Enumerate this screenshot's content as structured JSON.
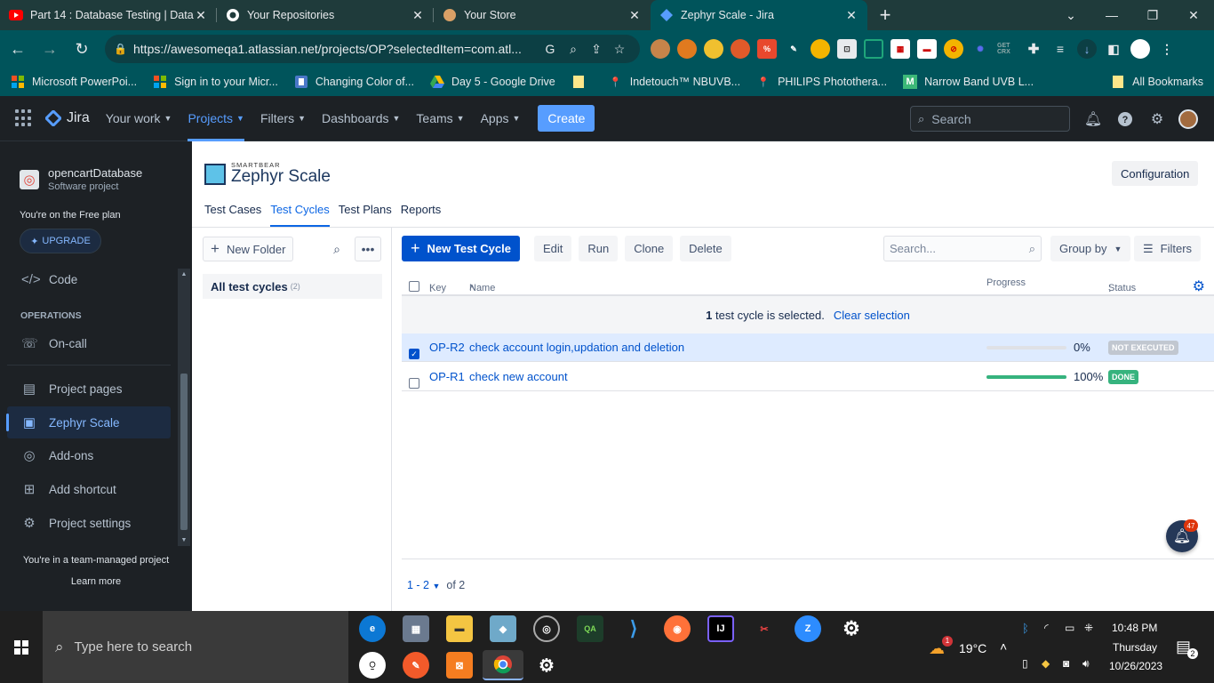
{
  "browser": {
    "tabs": [
      {
        "title": "Part 14 : Database Testing | Data",
        "icon": "youtube-icon",
        "icon_color": "#ff0000"
      },
      {
        "title": "Your Repositories",
        "icon": "github-icon",
        "icon_color": "#ffffff"
      },
      {
        "title": "Your Store",
        "icon": "store-icon",
        "icon_color": "#d9a066"
      },
      {
        "title": "Zephyr Scale - Jira",
        "icon": "jira-icon",
        "icon_color": "#579dff"
      }
    ],
    "url": "https://awesomeqa1.atlassian.net/projects/OP?selectedItem=com.atl...",
    "bookmarks": [
      {
        "label": "Microsoft PowerPoi...",
        "icon": "microsoft-icon"
      },
      {
        "label": "Sign in to your Micr...",
        "icon": "microsoft-icon"
      },
      {
        "label": "Changing Color of...",
        "icon": "bookmark-icon"
      },
      {
        "label": "Day 5 - Google Drive",
        "icon": "drive-icon"
      },
      {
        "label": "",
        "icon": "folder-icon"
      },
      {
        "label": "Indetouch™ NBUVB...",
        "icon": "pin-icon"
      },
      {
        "label": "PHILIPS Photothera...",
        "icon": "pin-icon"
      },
      {
        "label": "Narrow Band UVB L...",
        "icon": "m-icon"
      }
    ],
    "all_bookmarks": "All Bookmarks"
  },
  "jira": {
    "logo": "Jira",
    "menu": [
      "Your work",
      "Projects",
      "Filters",
      "Dashboards",
      "Teams",
      "Apps"
    ],
    "create": "Create",
    "search_placeholder": "Search"
  },
  "sidebar": {
    "project_name": "opencartDatabase",
    "project_type": "Software project",
    "plan": "You're on the Free plan",
    "upgrade": "UPGRADE",
    "code": "Code",
    "operations": "OPERATIONS",
    "oncall": "On-call",
    "items": [
      "Project pages",
      "Zephyr Scale",
      "Add-ons",
      "Add shortcut",
      "Project settings"
    ],
    "team_managed": "You're in a team-managed project",
    "learn_more": "Learn more"
  },
  "zephyr": {
    "brand_small": "SMARTBEAR",
    "brand": "Zephyr Scale",
    "configuration": "Configuration",
    "tabs": [
      "Test Cases",
      "Test Cycles",
      "Test Plans",
      "Reports"
    ],
    "new_folder": "New Folder",
    "all_cycles": "All test cycles",
    "all_cycles_count": "(2)",
    "new_test_cycle": "New Test Cycle",
    "actions": [
      "Edit",
      "Run",
      "Clone",
      "Delete"
    ],
    "search_placeholder": "Search...",
    "group_by": "Group by",
    "filters": "Filters",
    "columns": {
      "key": "Key",
      "name": "Name",
      "progress": "Progress",
      "status": "Status"
    },
    "selection_count": "1",
    "selection_text": "test cycle is selected.",
    "clear_selection": "Clear selection",
    "rows": [
      {
        "key": "OP-R2",
        "name": "check account login,updation and deletion",
        "progress": 0,
        "progress_label": "0%",
        "status": "NOT EXECUTED",
        "selected": true
      },
      {
        "key": "OP-R1",
        "name": "check new account",
        "progress": 100,
        "progress_label": "100%",
        "status": "DONE",
        "selected": false
      }
    ],
    "pager_range": "1 - 2",
    "pager_total": "of 2",
    "notifications": "47"
  },
  "taskbar": {
    "search": "Type here to search",
    "weather_badge": "1",
    "temperature": "19°C",
    "time": "10:48 PM",
    "day": "Thursday",
    "date": "10/26/2023",
    "notif_count": "2"
  }
}
